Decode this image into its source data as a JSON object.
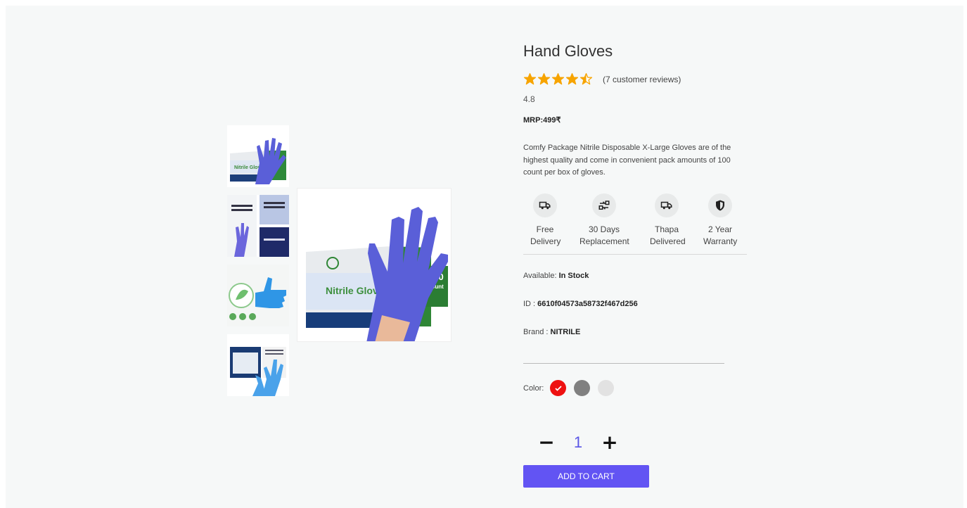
{
  "product": {
    "title": "Hand Gloves",
    "rating_value": "4.8",
    "rating_stars": 4.5,
    "reviews_text": "(7 customer reviews)",
    "mrp": "MRP:499₹",
    "description": "Comfy Package Nitrile Disposable X-Large Gloves are of the highest quality and come in convenient pack amounts of 100 count per box of gloves.",
    "main_image_box_text": "Nitrile Glove",
    "main_image_count": "100",
    "main_image_count_sub": "count"
  },
  "features": [
    {
      "icon": "truck-icon",
      "line1": "Free",
      "line2": "Delivery"
    },
    {
      "icon": "replacement-icon",
      "line1": "30 Days",
      "line2": "Replacement"
    },
    {
      "icon": "truck-icon",
      "line1": "Thapa",
      "line2": "Delivered"
    },
    {
      "icon": "shield-icon",
      "line1": "2 Year",
      "line2": "Warranty"
    }
  ],
  "info": {
    "available_label": "Available: ",
    "available_value": "In Stock",
    "id_label": "ID : ",
    "id_value": "6610f04573a58732f467d256",
    "brand_label": "Brand : ",
    "brand_value": "NITRILE"
  },
  "colors": {
    "label": "Color:",
    "swatches": [
      "#ee1111",
      "#808080",
      "#e2e2e2"
    ],
    "selected_index": 0
  },
  "quantity": {
    "minus": "−",
    "value": "1",
    "plus": "+"
  },
  "cart": {
    "label": "ADD TO CART"
  },
  "theme": {
    "accent": "#6254f3",
    "star": "#f7a400",
    "glove": "#5a5fd8"
  }
}
